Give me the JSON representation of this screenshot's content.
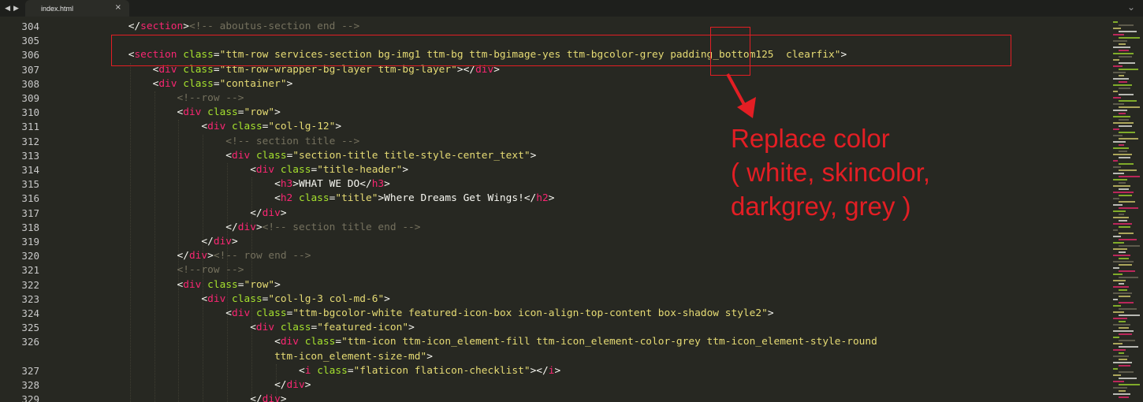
{
  "tabs": {
    "back_glyph": "◀",
    "forward_glyph": "▶",
    "active_title": "index.html",
    "close_glyph": "×",
    "more_glyph": "⌄"
  },
  "editor": {
    "colors": {
      "background": "#272822",
      "tag": "#f92672",
      "attribute": "#a6e22e",
      "string": "#e6db74",
      "comment": "#75715e",
      "plain": "#f8f8f2",
      "line_number": "#c8c8c8"
    },
    "line_numbers": [
      "304",
      "305",
      "306",
      "307",
      "308",
      "309",
      "310",
      "311",
      "312",
      "313",
      "314",
      "315",
      "316",
      "317",
      "318",
      "319",
      "320",
      "321",
      "322",
      "323",
      "324",
      "325",
      "326",
      "327",
      "328",
      "329"
    ],
    "lines": [
      {
        "indent": "            ",
        "tokens": [
          [
            "p",
            "</"
          ],
          [
            "t",
            "section"
          ],
          [
            "p",
            ">"
          ],
          [
            "c",
            "<!-- aboutus-section end -->"
          ]
        ]
      },
      {
        "indent": "",
        "tokens": []
      },
      {
        "indent": "            ",
        "tokens": [
          [
            "p",
            "<"
          ],
          [
            "t",
            "section"
          ],
          [
            "p",
            " "
          ],
          [
            "a",
            "class"
          ],
          [
            "p",
            "="
          ],
          [
            "s",
            "\"ttm-row services-section bg-img1 ttm-bg ttm-bgimage-yes ttm-bgcolor-grey padding_bottom125  clearfix\""
          ],
          [
            "p",
            ">"
          ]
        ]
      },
      {
        "indent": "                ",
        "tokens": [
          [
            "p",
            "<"
          ],
          [
            "t",
            "div"
          ],
          [
            "p",
            " "
          ],
          [
            "a",
            "class"
          ],
          [
            "p",
            "="
          ],
          [
            "s",
            "\"ttm-row-wrapper-bg-layer ttm-bg-layer\""
          ],
          [
            "p",
            "></"
          ],
          [
            "t",
            "div"
          ],
          [
            "p",
            ">"
          ]
        ]
      },
      {
        "indent": "                ",
        "tokens": [
          [
            "p",
            "<"
          ],
          [
            "t",
            "div"
          ],
          [
            "p",
            " "
          ],
          [
            "a",
            "class"
          ],
          [
            "p",
            "="
          ],
          [
            "s",
            "\"container\""
          ],
          [
            "p",
            ">"
          ]
        ]
      },
      {
        "indent": "                    ",
        "tokens": [
          [
            "c",
            "<!--row -->"
          ]
        ]
      },
      {
        "indent": "                    ",
        "tokens": [
          [
            "p",
            "<"
          ],
          [
            "t",
            "div"
          ],
          [
            "p",
            " "
          ],
          [
            "a",
            "class"
          ],
          [
            "p",
            "="
          ],
          [
            "s",
            "\"row\""
          ],
          [
            "p",
            ">"
          ]
        ]
      },
      {
        "indent": "                        ",
        "tokens": [
          [
            "p",
            "<"
          ],
          [
            "t",
            "div"
          ],
          [
            "p",
            " "
          ],
          [
            "a",
            "class"
          ],
          [
            "p",
            "="
          ],
          [
            "s",
            "\"col-lg-12\""
          ],
          [
            "p",
            ">"
          ]
        ]
      },
      {
        "indent": "                            ",
        "tokens": [
          [
            "c",
            "<!-- section title -->"
          ]
        ]
      },
      {
        "indent": "                            ",
        "tokens": [
          [
            "p",
            "<"
          ],
          [
            "t",
            "div"
          ],
          [
            "p",
            " "
          ],
          [
            "a",
            "class"
          ],
          [
            "p",
            "="
          ],
          [
            "s",
            "\"section-title title-style-center_text\""
          ],
          [
            "p",
            ">"
          ]
        ]
      },
      {
        "indent": "                                ",
        "tokens": [
          [
            "p",
            "<"
          ],
          [
            "t",
            "div"
          ],
          [
            "p",
            " "
          ],
          [
            "a",
            "class"
          ],
          [
            "p",
            "="
          ],
          [
            "s",
            "\"title-header\""
          ],
          [
            "p",
            ">"
          ]
        ]
      },
      {
        "indent": "                                    ",
        "tokens": [
          [
            "p",
            "<"
          ],
          [
            "t",
            "h3"
          ],
          [
            "p",
            ">WHAT WE DO</"
          ],
          [
            "t",
            "h3"
          ],
          [
            "p",
            ">"
          ]
        ]
      },
      {
        "indent": "                                    ",
        "tokens": [
          [
            "p",
            "<"
          ],
          [
            "t",
            "h2"
          ],
          [
            "p",
            " "
          ],
          [
            "a",
            "class"
          ],
          [
            "p",
            "="
          ],
          [
            "s",
            "\"title\""
          ],
          [
            "p",
            ">Where Dreams Get Wings!</"
          ],
          [
            "t",
            "h2"
          ],
          [
            "p",
            ">"
          ]
        ]
      },
      {
        "indent": "                                ",
        "tokens": [
          [
            "p",
            "</"
          ],
          [
            "t",
            "div"
          ],
          [
            "p",
            ">"
          ]
        ]
      },
      {
        "indent": "                            ",
        "tokens": [
          [
            "p",
            "</"
          ],
          [
            "t",
            "div"
          ],
          [
            "p",
            ">"
          ],
          [
            "c",
            "<!-- section title end -->"
          ]
        ]
      },
      {
        "indent": "                        ",
        "tokens": [
          [
            "p",
            "</"
          ],
          [
            "t",
            "div"
          ],
          [
            "p",
            ">"
          ]
        ]
      },
      {
        "indent": "                    ",
        "tokens": [
          [
            "p",
            "</"
          ],
          [
            "t",
            "div"
          ],
          [
            "p",
            ">"
          ],
          [
            "c",
            "<!-- row end -->"
          ]
        ]
      },
      {
        "indent": "                    ",
        "tokens": [
          [
            "c",
            "<!--row -->"
          ]
        ]
      },
      {
        "indent": "                    ",
        "tokens": [
          [
            "p",
            "<"
          ],
          [
            "t",
            "div"
          ],
          [
            "p",
            " "
          ],
          [
            "a",
            "class"
          ],
          [
            "p",
            "="
          ],
          [
            "s",
            "\"row\""
          ],
          [
            "p",
            ">"
          ]
        ]
      },
      {
        "indent": "                        ",
        "tokens": [
          [
            "p",
            "<"
          ],
          [
            "t",
            "div"
          ],
          [
            "p",
            " "
          ],
          [
            "a",
            "class"
          ],
          [
            "p",
            "="
          ],
          [
            "s",
            "\"col-lg-3 col-md-6\""
          ],
          [
            "p",
            ">"
          ]
        ]
      },
      {
        "indent": "                            ",
        "tokens": [
          [
            "p",
            "<"
          ],
          [
            "t",
            "div"
          ],
          [
            "p",
            " "
          ],
          [
            "a",
            "class"
          ],
          [
            "p",
            "="
          ],
          [
            "s",
            "\"ttm-bgcolor-white featured-icon-box icon-align-top-content box-shadow style2\""
          ],
          [
            "p",
            ">"
          ]
        ]
      },
      {
        "indent": "                                ",
        "tokens": [
          [
            "p",
            "<"
          ],
          [
            "t",
            "div"
          ],
          [
            "p",
            " "
          ],
          [
            "a",
            "class"
          ],
          [
            "p",
            "="
          ],
          [
            "s",
            "\"featured-icon\""
          ],
          [
            "p",
            ">"
          ]
        ]
      },
      {
        "indent": "                                    ",
        "tokens": [
          [
            "p",
            "<"
          ],
          [
            "t",
            "div"
          ],
          [
            "p",
            " "
          ],
          [
            "a",
            "class"
          ],
          [
            "p",
            "="
          ],
          [
            "s",
            "\"ttm-icon ttm-icon_element-fill ttm-icon_element-color-grey ttm-icon_element-style-round"
          ]
        ]
      },
      {
        "indent": "                                    ",
        "tokens": [
          [
            "s",
            "ttm-icon_element-size-md\""
          ],
          [
            "p",
            ">"
          ]
        ],
        "wrapped": true
      },
      {
        "indent": "                                        ",
        "tokens": [
          [
            "p",
            "<"
          ],
          [
            "t",
            "i"
          ],
          [
            "p",
            " "
          ],
          [
            "a",
            "class"
          ],
          [
            "p",
            "="
          ],
          [
            "s",
            "\"flaticon flaticon-checklist\""
          ],
          [
            "p",
            "></"
          ],
          [
            "t",
            "i"
          ],
          [
            "p",
            ">"
          ]
        ]
      },
      {
        "indent": "                                    ",
        "tokens": [
          [
            "p",
            "</"
          ],
          [
            "t",
            "div"
          ],
          [
            "p",
            ">"
          ]
        ]
      },
      {
        "indent": "                                ",
        "tokens": [
          [
            "p",
            "</"
          ],
          [
            "t",
            "div"
          ],
          [
            "p",
            ">"
          ]
        ]
      }
    ]
  },
  "annotation": {
    "line1": "Replace color",
    "line2": "( white, skincolor,",
    "line3": "darkgrey, grey )",
    "color": "#e31e24"
  }
}
